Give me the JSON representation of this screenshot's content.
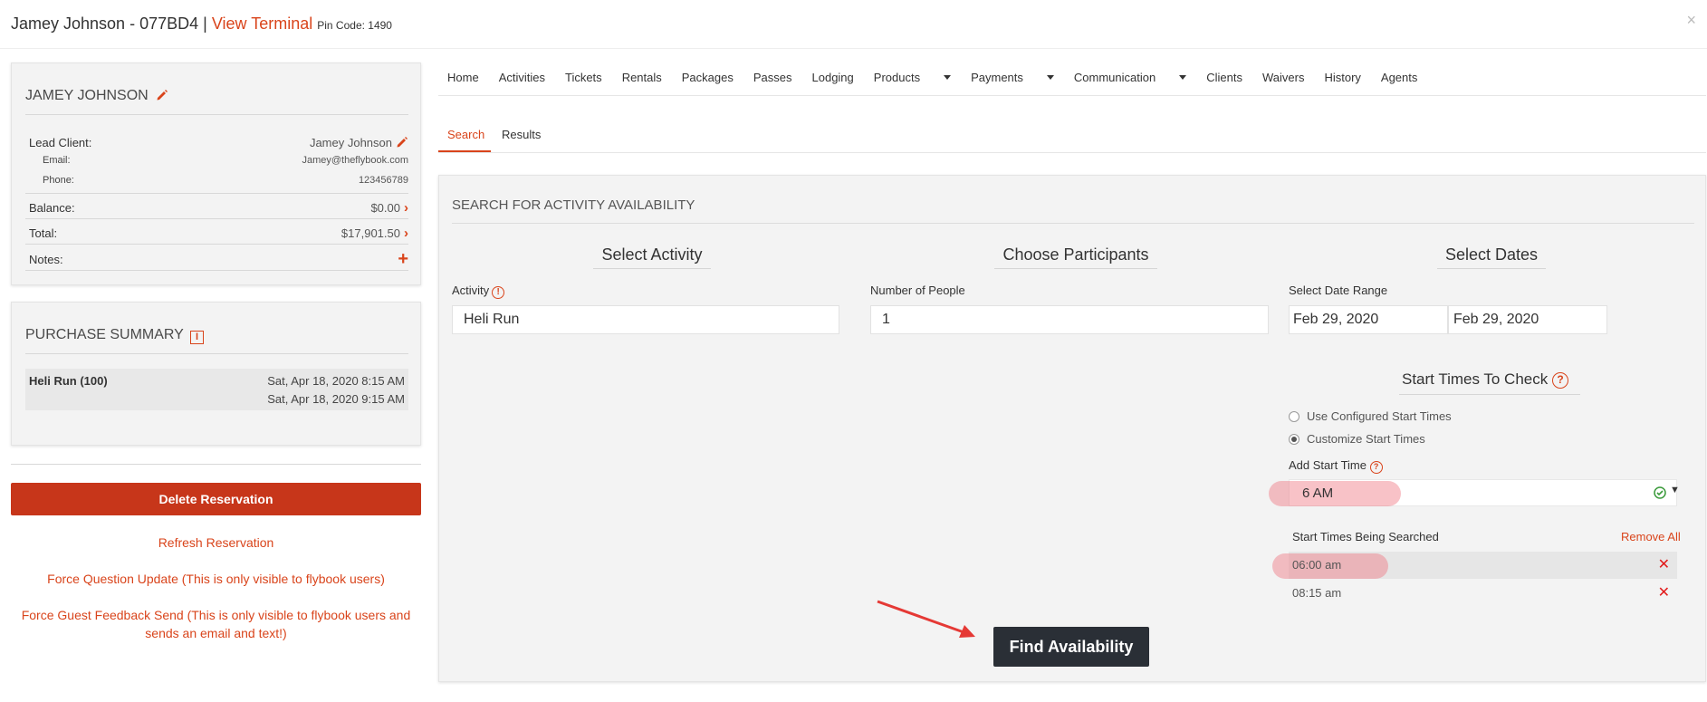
{
  "header": {
    "client_name": "Jamey Johnson - 077BD4",
    "separator": "|",
    "view_terminal": "View Terminal",
    "pin_code": "Pin Code: 1490",
    "close": "×"
  },
  "client_card": {
    "title": "JAMEY JOHNSON",
    "lead_client_label": "Lead Client:",
    "lead_client_value": "Jamey Johnson",
    "email_label": "Email:",
    "email_value": "Jamey@theflybook.com",
    "phone_label": "Phone:",
    "phone_value": "123456789",
    "balance_label": "Balance:",
    "balance_value": "$0.00",
    "total_label": "Total:",
    "total_value": "$17,901.50",
    "notes_label": "Notes:",
    "notes_add": "+"
  },
  "purchase_summary": {
    "title": "PURCHASE SUMMARY",
    "items": [
      {
        "name": "Heli Run (100)",
        "start": "Sat, Apr 18, 2020 8:15 AM",
        "end": "Sat, Apr 18, 2020 9:15 AM"
      }
    ]
  },
  "actions": {
    "delete": "Delete Reservation",
    "refresh": "Refresh Reservation",
    "force_question": "Force Question Update (This is only visible to flybook users)",
    "force_feedback_line1": "Force Guest Feedback Send (This is only visible to flybook users and",
    "force_feedback_line2": "sends an email and text!)"
  },
  "nav": {
    "items": [
      "Home",
      "Activities",
      "Tickets",
      "Rentals",
      "Packages",
      "Passes",
      "Lodging",
      "Products",
      "Payments",
      "Communication",
      "Clients",
      "Waivers",
      "History",
      "Agents"
    ]
  },
  "tabs": {
    "search": "Search",
    "results": "Results"
  },
  "search": {
    "title": "SEARCH FOR ACTIVITY AVAILABILITY",
    "select_activity_hd": "Select Activity",
    "choose_participants_hd": "Choose Participants",
    "select_dates_hd": "Select Dates",
    "activity_label": "Activity",
    "activity_value": "Heli Run",
    "people_label": "Number of People",
    "people_value": "1",
    "date_range_label": "Select Date Range",
    "date_from": "Feb 29, 2020",
    "date_to": "Feb 29, 2020",
    "start_times_hd": "Start Times To Check",
    "opt_configured": "Use Configured Start Times",
    "opt_customize": "Customize Start Times",
    "add_start_label": "Add Start Time",
    "add_start_value": "6 AM",
    "searched_label": "Start Times Being Searched",
    "remove_all": "Remove All",
    "times": [
      "06:00 am",
      "08:15 am"
    ],
    "find": "Find Availability"
  }
}
